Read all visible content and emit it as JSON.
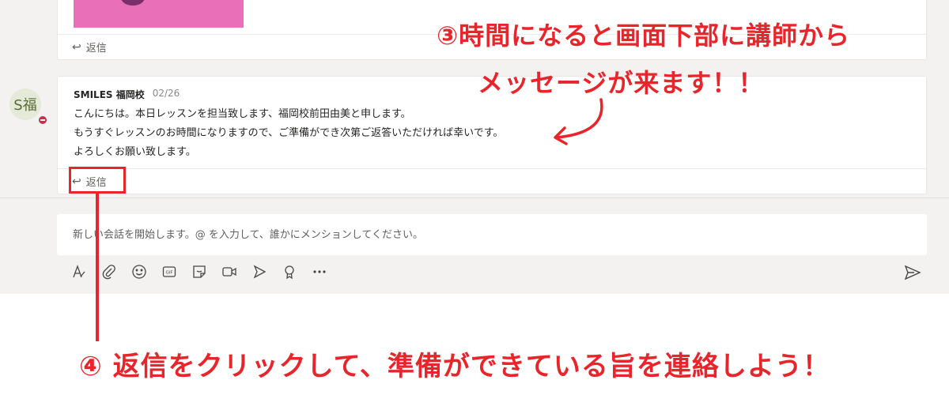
{
  "thread": {
    "first_message": {
      "reply_label": "返信"
    },
    "second_message": {
      "avatar_initials": "S福",
      "sender": "SMILES 福岡校",
      "date": "02/26",
      "lines": [
        "こんにちは。本日レッスンを担当致します、福岡校前田由美と申します。",
        "もうすぐレッスンのお時間になりますので、ご準備ができ次第ご返答いただければ幸いです。",
        "よろしくお願い致します。"
      ],
      "reply_label": "返信"
    }
  },
  "compose": {
    "placeholder": "新しい会話を開始します。@ を入力して、誰かにメンションしてください。"
  },
  "toolbar": {
    "icons": [
      "format-icon",
      "attach-icon",
      "emoji-icon",
      "gif-icon",
      "sticker-icon",
      "meet-icon",
      "stream-icon",
      "praise-icon",
      "more-icon",
      "send-icon"
    ]
  },
  "annotations": {
    "step3_line1": "③時間になると画面下部に講師から",
    "step3_line2": "メッセージが来ます！！",
    "step4": "④ 返信をクリックして、準備ができている旨を連絡しよう！",
    "color": "#e8252a"
  },
  "colors": {
    "background": "#f3f2f1",
    "card": "#ffffff",
    "presence_busy": "#c4314b",
    "thumbnail": "#e86fb8"
  }
}
